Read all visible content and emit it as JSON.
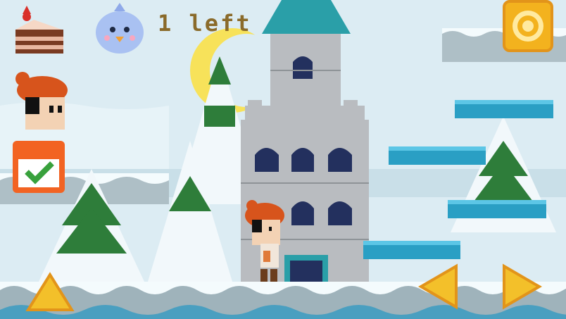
{
  "hud": {
    "remaining_text": "1 left",
    "cake_icon": "cake-slice-icon",
    "bird_icon": "blue-bird-icon",
    "player_icon": "player-face-icon",
    "task_icon": "calendar-check-icon",
    "settings_icon": "gear-icon"
  },
  "controls": {
    "jump_icon": "triangle-up-icon",
    "left_icon": "triangle-left-icon",
    "right_icon": "triangle-right-icon"
  },
  "colors": {
    "sky": "#dcecf3",
    "snow": "#f4fbfd",
    "tower_stone": "#b9bcc0",
    "platform": "#2a9fc4",
    "button_orange": "#f3b21e",
    "pine": "#2e7d3a",
    "hud_text": "#8a6a2a"
  }
}
